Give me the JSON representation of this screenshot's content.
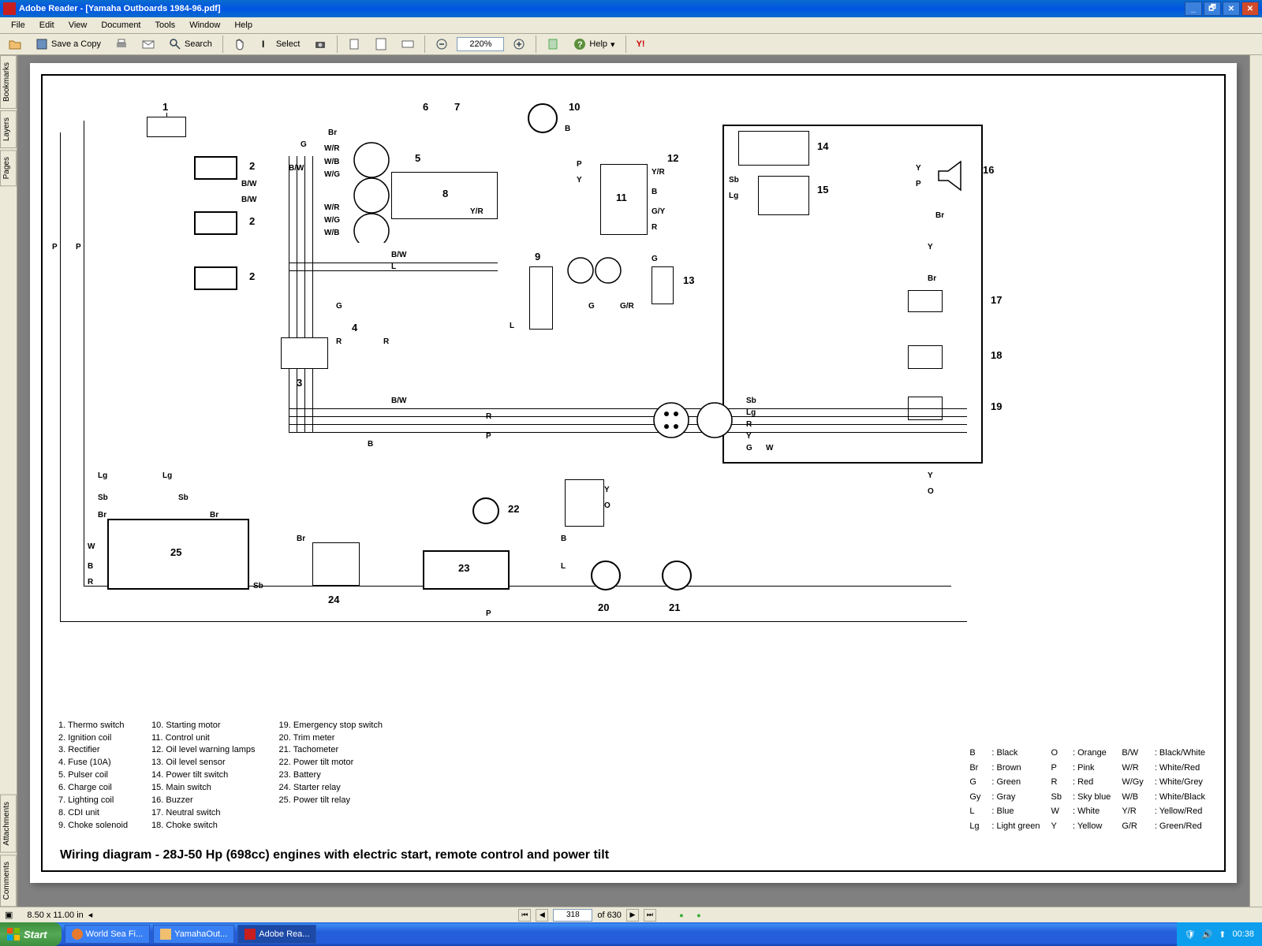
{
  "title": "Adobe Reader - [Yamaha Outboards 1984-96.pdf]",
  "menu": [
    "File",
    "Edit",
    "View",
    "Document",
    "Tools",
    "Window",
    "Help"
  ],
  "toolbar": {
    "save": "Save a Copy",
    "print": "Print",
    "search": "Search",
    "select": "Select",
    "zoom": "220%",
    "help": "Help"
  },
  "sidetabs": [
    "Bookmarks",
    "Layers",
    "Pages"
  ],
  "sidetabs2": [
    "Attachments",
    "Comments"
  ],
  "diagram": {
    "caption": "Wiring diagram - 28J-50 Hp (698cc) engines with electric start, remote control and power tilt",
    "callouts": [
      "1",
      "2",
      "3",
      "4",
      "5",
      "6",
      "7",
      "8",
      "9",
      "10",
      "11",
      "12",
      "13",
      "14",
      "15",
      "16",
      "17",
      "18",
      "19",
      "20",
      "21",
      "22",
      "23",
      "24",
      "25"
    ],
    "wires": [
      "P",
      "B",
      "B/W",
      "G",
      "Br",
      "W/R",
      "W/B",
      "W/G",
      "L",
      "R",
      "W",
      "Y",
      "Y/R",
      "Sb",
      "Lg",
      "G/R",
      "G/Y",
      "O"
    ]
  },
  "legend": {
    "c1": [
      "1. Thermo switch",
      "2. Ignition coil",
      "3. Rectifier",
      "4. Fuse (10A)",
      "5. Pulser coil",
      "6. Charge coil",
      "7. Lighting coil",
      "8. CDI unit",
      "9. Choke solenoid"
    ],
    "c2": [
      "10. Starting motor",
      "11. Control unit",
      "12. Oil level warning lamps",
      "13. Oil level sensor",
      "14. Power tilt switch",
      "15. Main switch",
      "16. Buzzer",
      "17. Neutral switch",
      "18. Choke switch"
    ],
    "c3": [
      "19. Emergency stop switch",
      "20. Trim meter",
      "21. Tachometer",
      "22. Power tilt motor",
      "23. Battery",
      "24. Starter relay",
      "25. Power tilt relay"
    ]
  },
  "colors": [
    [
      "B",
      ": Black"
    ],
    [
      "O",
      ": Orange"
    ],
    [
      "B/W",
      ": Black/White"
    ],
    [
      "Br",
      ": Brown"
    ],
    [
      "P",
      ": Pink"
    ],
    [
      "W/R",
      ": White/Red"
    ],
    [
      "G",
      ": Green"
    ],
    [
      "R",
      ": Red"
    ],
    [
      "W/Gy",
      ": White/Grey"
    ],
    [
      "Gy",
      ": Gray"
    ],
    [
      "Sb",
      ": Sky blue"
    ],
    [
      "W/B",
      ": White/Black"
    ],
    [
      "L",
      ": Blue"
    ],
    [
      "W",
      ": White"
    ],
    [
      "Y/R",
      ": Yellow/Red"
    ],
    [
      "Lg",
      ": Light green"
    ],
    [
      "Y",
      ": Yellow"
    ],
    [
      "G/R",
      ": Green/Red"
    ]
  ],
  "status": {
    "dim": "8.50 x 11.00 in",
    "page": "318",
    "total": "of 630"
  },
  "taskbar": {
    "start": "Start",
    "items": [
      "World Sea Fi...",
      "YamahaOut...",
      "Adobe Rea..."
    ],
    "clock": "00:38"
  }
}
